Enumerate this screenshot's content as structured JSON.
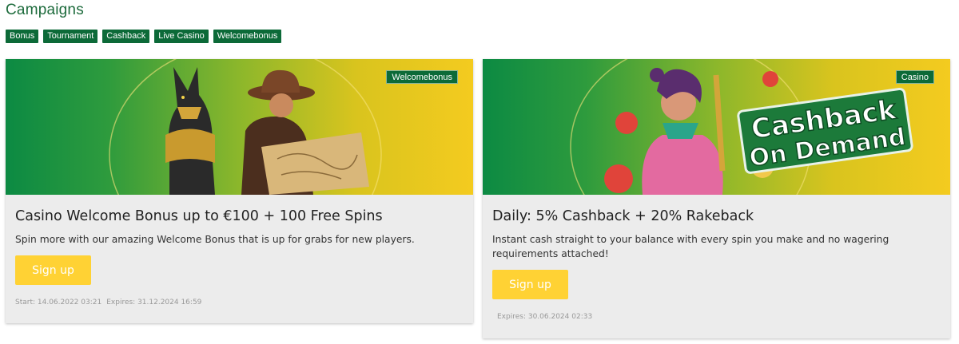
{
  "page": {
    "title": "Campaigns"
  },
  "filters": [
    "Bonus",
    "Tournament",
    "Cashback",
    "Live Casino",
    "Welcomebonus"
  ],
  "cards": [
    {
      "badge": "Welcomebonus",
      "title": "Casino Welcome Bonus up to €100 + 100 Free Spins",
      "description": "Spin more with our amazing Welcome Bonus that is up for grabs for new players.",
      "button": "Sign up",
      "start": "Start: 14.06.2022 03:21",
      "expires": "Expires: 31.12.2024 16:59"
    },
    {
      "badge": "Casino",
      "banner_text_1": "Cashback",
      "banner_text_2": "On Demand",
      "title": "Daily: 5% Cashback + 20% Rakeback",
      "description": "Instant cash straight to your balance with every spin you make and no wagering requirements attached!",
      "button": "Sign up",
      "expires": "Expires: 30.06.2024 02:33"
    }
  ],
  "colors": {
    "accent_green": "#0c6a38",
    "button_yellow": "#ffd234",
    "title_green": "#1d6b3c"
  }
}
